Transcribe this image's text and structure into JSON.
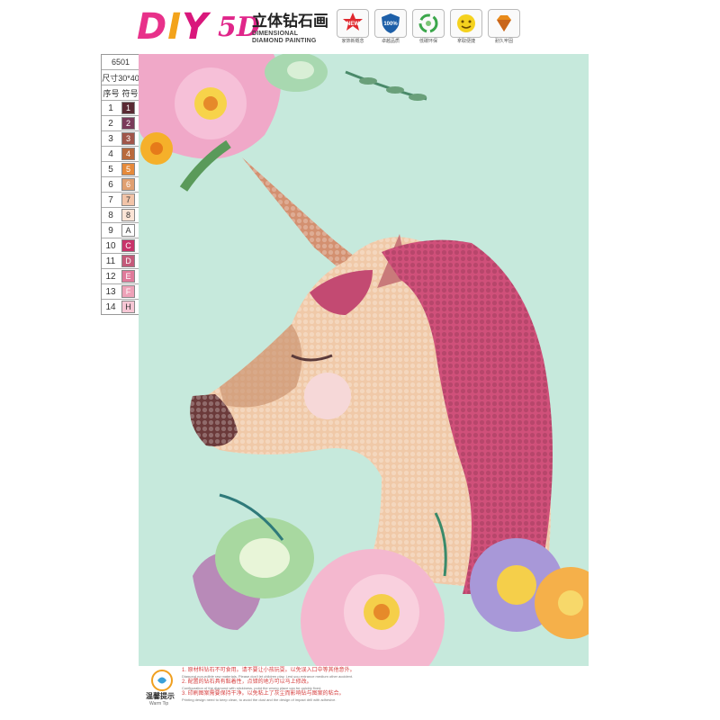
{
  "header": {
    "diy_d": "D",
    "diy_i": "I",
    "diy_y": "Y",
    "fived": "5D",
    "brand_cn": "立体钻石画",
    "brand_en_1": "DIMENSIONAL",
    "brand_en_2": "DIAMOND PAINTING",
    "badges": [
      {
        "icon": "new-star-icon",
        "top": "NEW",
        "label": "家饰新概念"
      },
      {
        "icon": "shield-icon",
        "top": "100%",
        "label": "卓越品质"
      },
      {
        "icon": "recycle-icon",
        "top": "",
        "label": "低碳环保"
      },
      {
        "icon": "easy-sticker-icon",
        "top": "",
        "label": "拿取便捷"
      },
      {
        "icon": "diamond-icon",
        "top": "",
        "label": "耐久牢固"
      }
    ]
  },
  "legend": {
    "code": "6501",
    "size": "尺寸30*40",
    "col_num": "序号",
    "col_sym": "符号",
    "rows": [
      {
        "num": "1",
        "sym": "1",
        "color": "#5a2a34",
        "text": "#ffffff"
      },
      {
        "num": "2",
        "sym": "2",
        "color": "#7a3a5a",
        "text": "#ffffff"
      },
      {
        "num": "3",
        "sym": "3",
        "color": "#a0564a",
        "text": "#ffffff"
      },
      {
        "num": "4",
        "sym": "4",
        "color": "#b86a3c",
        "text": "#ffffff"
      },
      {
        "num": "5",
        "sym": "5",
        "color": "#e58a3a",
        "text": "#ffffff"
      },
      {
        "num": "6",
        "sym": "6",
        "color": "#e0a070",
        "text": "#ffffff"
      },
      {
        "num": "7",
        "sym": "7",
        "color": "#f2c4a8",
        "text": "#333333"
      },
      {
        "num": "8",
        "sym": "8",
        "color": "#fbe4d6",
        "text": "#333333"
      },
      {
        "num": "9",
        "sym": "A",
        "color": "#ffffff",
        "text": "#333333"
      },
      {
        "num": "10",
        "sym": "C",
        "color": "#c8346a",
        "text": "#ffffff"
      },
      {
        "num": "11",
        "sym": "D",
        "color": "#c45a7a",
        "text": "#ffffff"
      },
      {
        "num": "12",
        "sym": "E",
        "color": "#e07a9a",
        "text": "#ffffff"
      },
      {
        "num": "13",
        "sym": "F",
        "color": "#eea2b8",
        "text": "#ffffff"
      },
      {
        "num": "14",
        "sym": "H",
        "color": "#f6c6d4",
        "text": "#333333"
      }
    ]
  },
  "colors": {
    "canvas_bg": "#c6e9dc",
    "mane": "#d0507a",
    "body": "#f0c9a8",
    "shade": "#b97a55",
    "muzzle": "#6b3a3a"
  },
  "tips": {
    "title": "温馨提示",
    "subtitle": "Warm Tip",
    "lines": [
      {
        "cn": "1. 原材料钻石不可食用。请不要让小孩玩耍。以免误入口中等其他意外。",
        "en": "Diamond non-edible raw materials. Please don't let children play. Lest you entrance medium other accident."
      },
      {
        "cn": "2. 配置的钻石具有黏着性，点错的地方可以马上修改。",
        "en": "Configuration of the diamond with stickiness, point the wrong place can be quickly fixed."
      },
      {
        "cn": "3. 印刷图案需要保持干净。以免粘上了灰尘而影响钻与图案的粘合。",
        "en": "Printing design need to keep clean, to avoid the dust and the design of impact drill with adhesive."
      }
    ]
  }
}
